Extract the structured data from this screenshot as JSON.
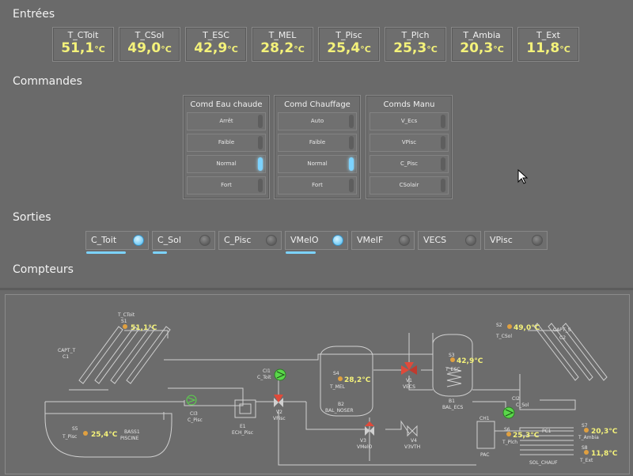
{
  "sections": {
    "entrees": "Entrées",
    "commandes": "Commandes",
    "sorties": "Sorties",
    "compteurs": "Compteurs"
  },
  "inputs": [
    {
      "label": "T_CToit",
      "value": "51,1",
      "unit": "°C"
    },
    {
      "label": "T_CSol",
      "value": "49,0",
      "unit": "°C"
    },
    {
      "label": "T_ESC",
      "value": "42,9",
      "unit": "°C"
    },
    {
      "label": "T_MEL",
      "value": "28,2",
      "unit": "°C"
    },
    {
      "label": "T_Pisc",
      "value": "25,4",
      "unit": "°C"
    },
    {
      "label": "T_Plch",
      "value": "25,3",
      "unit": "°C"
    },
    {
      "label": "T_Ambia",
      "value": "20,3",
      "unit": "°C"
    },
    {
      "label": "T_Ext",
      "value": "11,8",
      "unit": "°C"
    }
  ],
  "commands": [
    {
      "title": "Comd Eau chaude",
      "buttons": [
        {
          "label": "Arrêt",
          "active": false
        },
        {
          "label": "Faible",
          "active": false
        },
        {
          "label": "Normal",
          "active": true
        },
        {
          "label": "Fort",
          "active": false
        }
      ]
    },
    {
      "title": "Comd Chauffage",
      "buttons": [
        {
          "label": "Auto",
          "active": false
        },
        {
          "label": "Faible",
          "active": false
        },
        {
          "label": "Normal",
          "active": true
        },
        {
          "label": "Fort",
          "active": false
        }
      ]
    },
    {
      "title": "Comds Manu",
      "buttons": [
        {
          "label": "V_Ecs",
          "active": false
        },
        {
          "label": "VPisc",
          "active": false
        },
        {
          "label": "C_Pisc",
          "active": false
        },
        {
          "label": "CSolair",
          "active": false
        }
      ]
    }
  ],
  "outputs": [
    {
      "label": "C_Toit",
      "on": true,
      "level": 0.62
    },
    {
      "label": "C_Sol",
      "on": false,
      "level": 0.22
    },
    {
      "label": "C_Pisc",
      "on": false,
      "level": 0
    },
    {
      "label": "VMelO",
      "on": true,
      "level": 0.48
    },
    {
      "label": "VMelF",
      "on": false,
      "level": 0
    },
    {
      "label": "VECS",
      "on": false,
      "level": 0
    },
    {
      "label": "VPisc",
      "on": false,
      "level": 0
    }
  ],
  "synoptic": {
    "capt_t": {
      "name": "CAPT_T",
      "id": "C1"
    },
    "capt_s": {
      "name": "CAPT_S",
      "id": "C2"
    },
    "s1": {
      "id": "S1",
      "name": "T_CToit",
      "value": "51,1°C"
    },
    "s2": {
      "id": "S2",
      "name": "T_CSol",
      "value": "49,0°C"
    },
    "s3": {
      "id": "S3",
      "name": "T_ESC",
      "value": "42,9°C"
    },
    "s4": {
      "id": "S4",
      "name": "T_MEL",
      "value": "28,2°C"
    },
    "s5": {
      "id": "S5",
      "name": "T_Pisc",
      "value": "25,4°C"
    },
    "s6": {
      "id": "S6",
      "name": "T_Plch",
      "value": "25,3°C"
    },
    "s7": {
      "id": "S7",
      "name": "T_Ambia",
      "value": "20,3°C"
    },
    "s8": {
      "id": "S8",
      "name": "T_Ext",
      "value": "11,8°C"
    },
    "ci1": {
      "id": "CI1",
      "name": "C_Toit"
    },
    "ci2": {
      "id": "CI2",
      "name": "C_Sol"
    },
    "ci3": {
      "id": "CI3",
      "name": "C_Pisc"
    },
    "e1": {
      "id": "E1",
      "name": "ECH_Pisc"
    },
    "v1": {
      "id": "V1",
      "name": "VECS"
    },
    "v2": {
      "id": "V2",
      "name": "VPisc"
    },
    "v3": {
      "id": "V3",
      "name": "VMelO"
    },
    "v4": {
      "id": "V4",
      "name": "V3VTH"
    },
    "b1": {
      "id": "B1",
      "name": "BAL_ECS"
    },
    "b2": {
      "id": "B2",
      "name": "BAL_NOSER"
    },
    "bass": {
      "id": "BASS1",
      "name": "PISCINE"
    },
    "pac": {
      "id": "CH1",
      "name": "PAC"
    },
    "pc1": {
      "id": "PC1",
      "name": "SOL_CHAUF"
    }
  },
  "colors": {
    "value_yellow": "#f4f27a",
    "led_blue": "#7cd3ff",
    "pump_green": "#5ad84a",
    "valve_red": "#e04a3a",
    "sensor_orange": "#e0a040"
  }
}
